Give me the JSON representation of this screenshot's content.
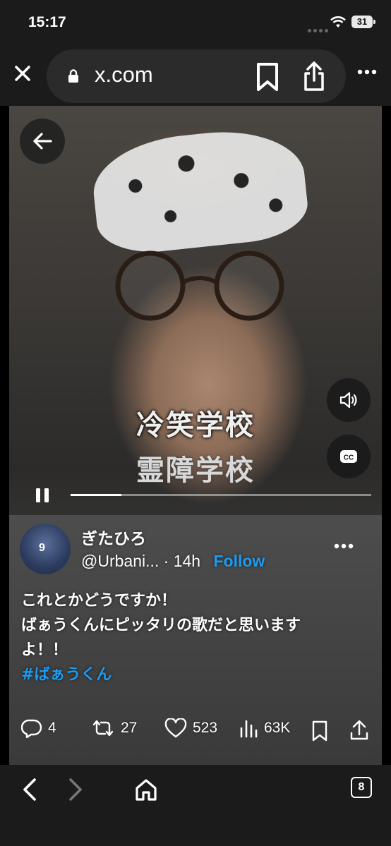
{
  "status": {
    "time": "15:17",
    "battery": "31"
  },
  "browser": {
    "url": "x.com"
  },
  "video": {
    "caption_top": "冷笑学校",
    "caption_bottom": "霊障学校",
    "progress": 0.17
  },
  "post": {
    "avatar_number": "9",
    "display_name": "ぎたひろ",
    "handle": "@Urbani...",
    "time": "· 14h",
    "follow_label": "Follow",
    "text_lines": [
      "これとかどうですか！",
      "ばぁうくんにピッタリの歌だと思います",
      "よ！！"
    ],
    "hashtag": "#ばぁうくん",
    "replies": "4",
    "reposts": "27",
    "likes": "523",
    "views": "63K"
  },
  "bottom_nav": {
    "tab_count": "8"
  },
  "icons": [
    "close-icon",
    "lock-icon",
    "bookmark-icon",
    "share-icon",
    "more-icon",
    "back-arrow-icon",
    "volume-icon",
    "cc-icon",
    "pause-icon",
    "reply-icon",
    "repost-icon",
    "like-icon",
    "views-icon",
    "chevron-left-icon",
    "chevron-right-icon",
    "home-icon",
    "tabs-icon"
  ],
  "colors": {
    "accent": "#1d9bf0",
    "bar": "#1b1b1b"
  }
}
